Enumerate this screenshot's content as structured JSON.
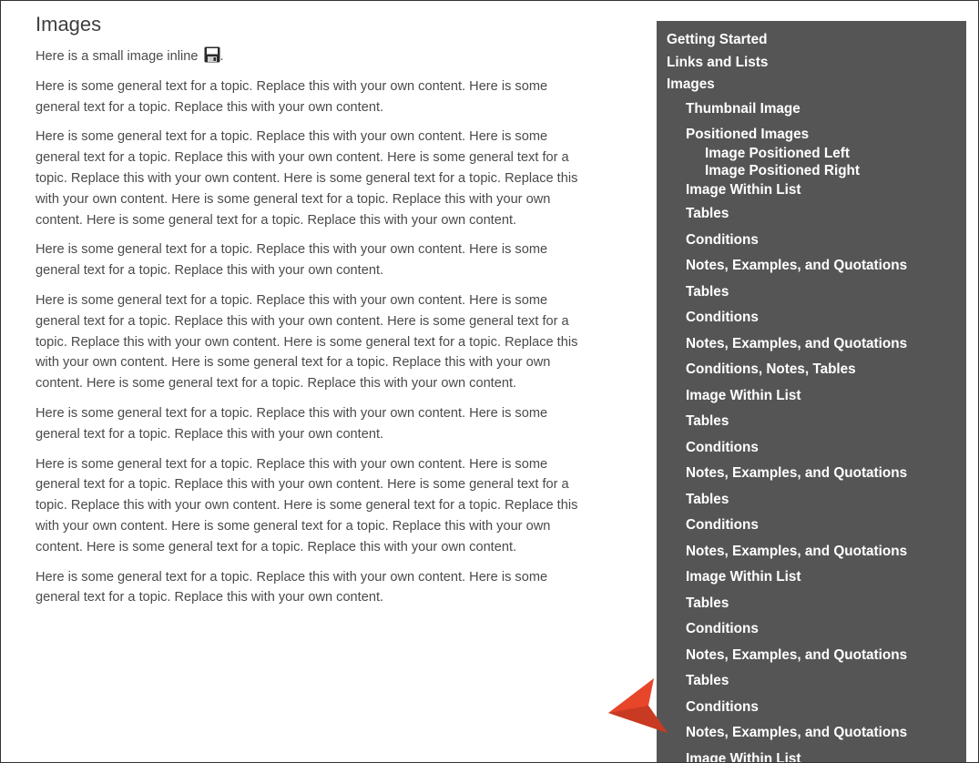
{
  "page": {
    "title": "Images",
    "inline_text": "Here is a small image inline",
    "inline_after": ".",
    "paragraphs": [
      "Here is some general text for a topic. Replace this with your own content. Here is some general text for a topic. Replace this with your own content.",
      "Here is some general text for a topic. Replace this with your own content. Here is some general text for a topic. Replace this with your own content. Here is some general text for a topic. Replace this with your own content. Here is some general text for a topic. Replace this with your own content. Here is some general text for a topic. Replace this with your own content. Here is some general text for a topic. Replace this with your own content.",
      "Here is some general text for a topic. Replace this with your own content. Here is some general text for a topic. Replace this with your own content.",
      "Here is some general text for a topic. Replace this with your own content. Here is some general text for a topic. Replace this with your own content. Here is some general text for a topic. Replace this with your own content. Here is some general text for a topic. Replace this with your own content. Here is some general text for a topic. Replace this with your own content. Here is some general text for a topic. Replace this with your own content.",
      "Here is some general text for a topic. Replace this with your own content. Here is some general text for a topic. Replace this with your own content.",
      "Here is some general text for a topic. Replace this with your own content. Here is some general text for a topic. Replace this with your own content. Here is some general text for a topic. Replace this with your own content. Here is some general text for a topic. Replace this with your own content. Here is some general text for a topic. Replace this with your own content. Here is some general text for a topic. Replace this with your own content.",
      "Here is some general text for a topic. Replace this with your own content. Here is some general text for a topic. Replace this with your own content."
    ]
  },
  "sidebar": {
    "top_items": [
      "Getting Started",
      "Links and Lists",
      "Images"
    ],
    "sub_items": [
      "Thumbnail Image",
      "Positioned Images"
    ],
    "sub_sub_items": [
      "Image Positioned Left",
      "Image Positioned Right"
    ],
    "rest_items": [
      "Image Within List",
      "Tables",
      "Conditions",
      "Notes, Examples, and Quotations",
      "Tables",
      "Conditions",
      "Notes, Examples, and Quotations",
      "Conditions, Notes, Tables",
      "Image Within List",
      "Tables",
      "Conditions",
      "Notes, Examples, and Quotations",
      "Tables",
      "Conditions",
      "Notes, Examples, and Quotations",
      "Image Within List",
      "Tables",
      "Conditions",
      "Notes, Examples, and Quotations",
      "Tables",
      "Conditions",
      "Notes, Examples, and Quotations",
      "Image Within List"
    ]
  },
  "colors": {
    "sidebar_bg": "#555555",
    "pointer": "#e8462a"
  },
  "icons": {
    "inline_image": "save-icon",
    "pointer": "arrow-pointer-icon"
  }
}
